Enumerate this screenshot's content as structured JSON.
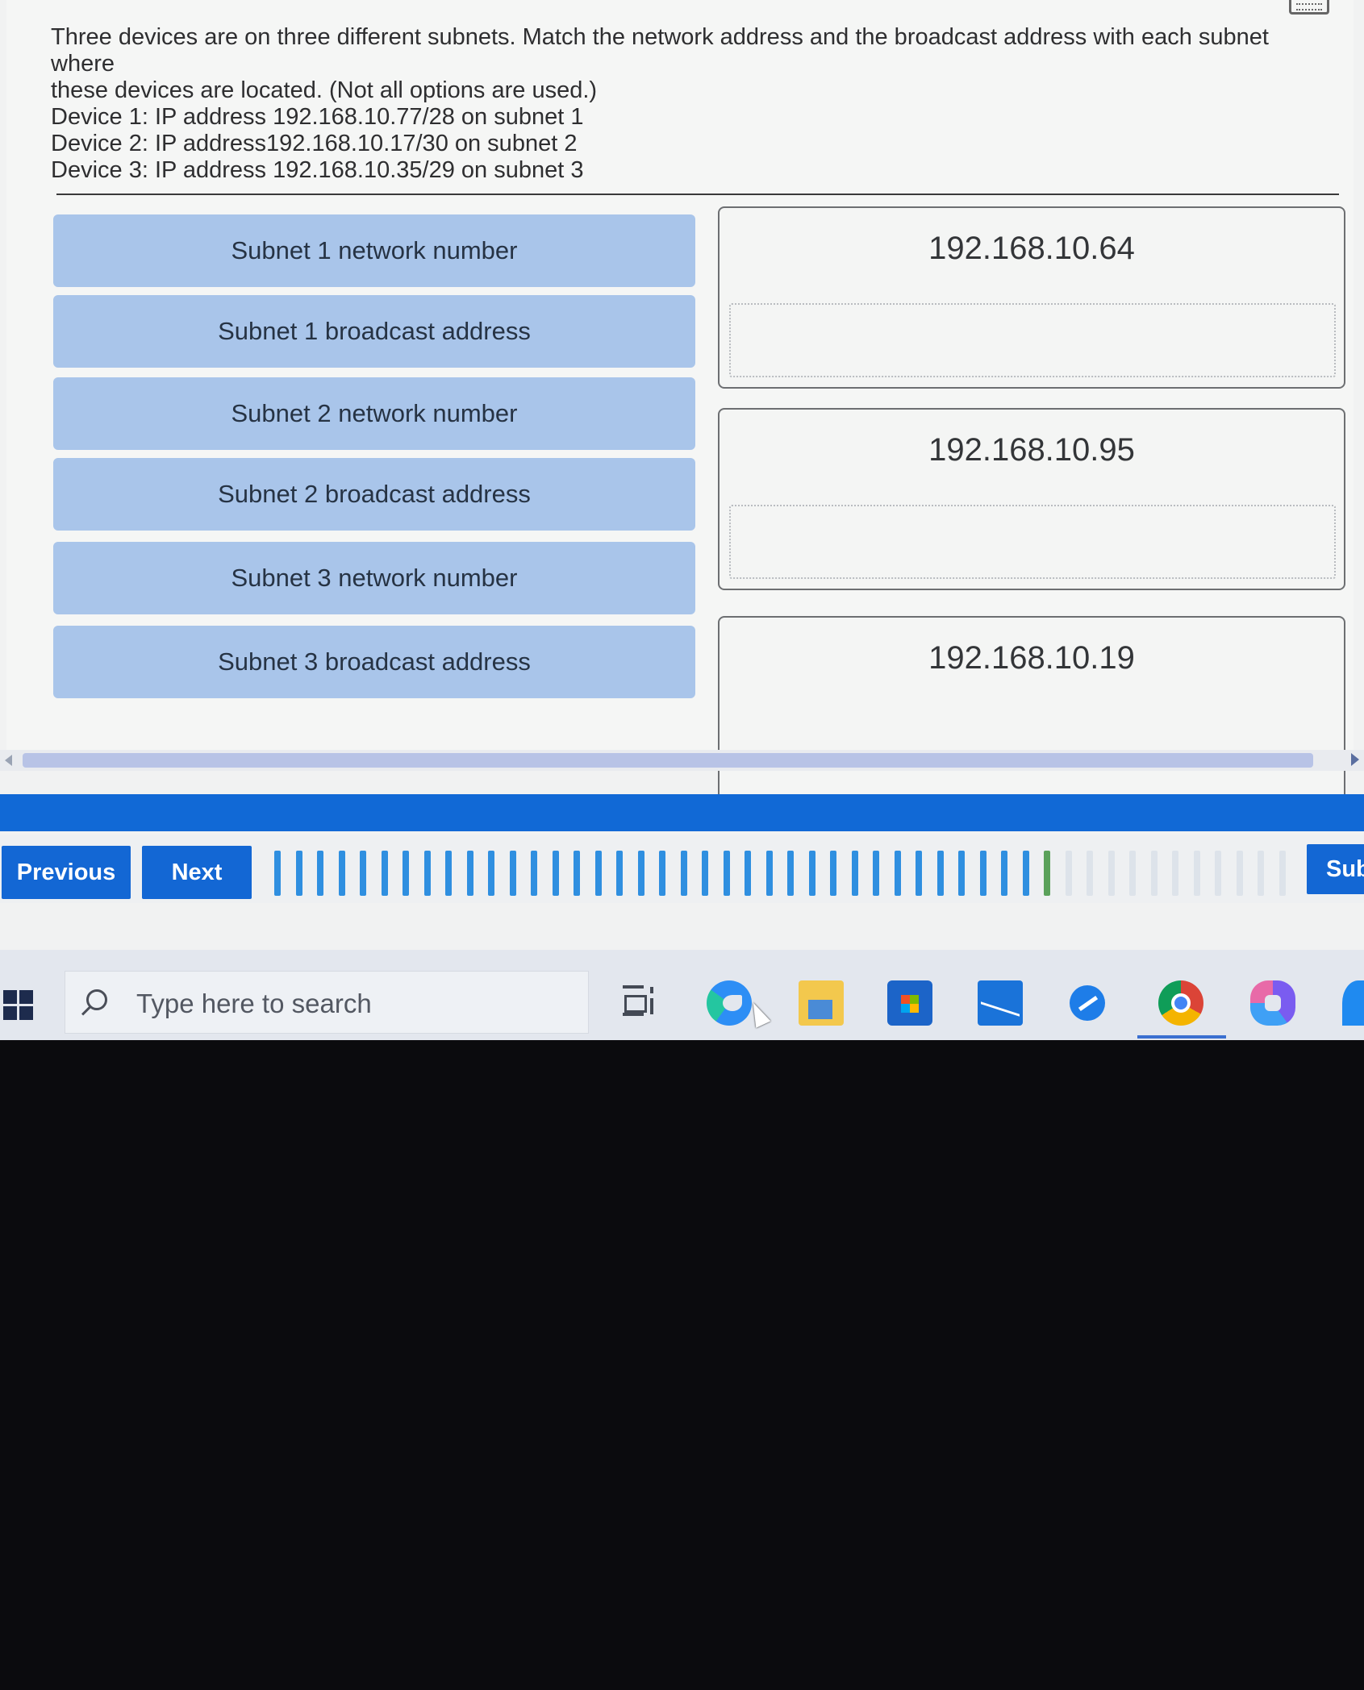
{
  "question": {
    "lines": [
      "Three devices are on three different subnets. Match the network address and the broadcast address with each subnet where",
      "these devices are located. (Not all options are used.)",
      "Device 1: IP address 192.168.10.77/28 on subnet 1",
      "Device 2: IP address192.168.10.17/30 on subnet 2",
      "Device 3: IP address 192.168.10.35/29 on subnet 3"
    ]
  },
  "labels": [
    "Subnet 1 network number",
    "Subnet 1 broadcast address",
    "Subnet 2 network number",
    "Subnet 2 broadcast address",
    "Subnet 3 network number",
    "Subnet 3 broadcast address"
  ],
  "options": [
    "192.168.10.64",
    "192.168.10.95",
    "192.168.10.19"
  ],
  "navigation": {
    "previous_label": "Previous",
    "next_label": "Next",
    "submit_label": "Sub"
  },
  "progress": {
    "total_ticks": 48,
    "current_tick": 36
  },
  "colors": {
    "accent_blue": "#1367d4",
    "label_bg": "#a9c5ea",
    "tick_done": "#2f8fe0",
    "tick_current": "#5aa15a",
    "tick_todo": "#dde3ea"
  },
  "taskbar": {
    "search_placeholder": "Type here to search",
    "icons": [
      "windows-icon",
      "task-view-icon",
      "edge-icon",
      "file-explorer-icon",
      "store-icon",
      "mail-icon",
      "tools-icon",
      "chrome-icon",
      "copilot-icon"
    ]
  }
}
